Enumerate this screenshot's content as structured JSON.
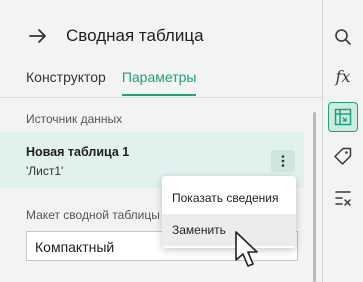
{
  "header": {
    "title": "Сводная таблица"
  },
  "tabs": [
    {
      "label": "Конструктор",
      "active": false
    },
    {
      "label": "Параметры",
      "active": true
    }
  ],
  "data_source": {
    "section_label": "Источник данных",
    "name": "Новая таблица 1",
    "sheet": "'Лист1'"
  },
  "layout": {
    "section_label": "Макет сводной таблицы",
    "selected": "Компактный"
  },
  "context_menu": {
    "items": [
      {
        "label": "Показать сведения"
      },
      {
        "label": "Заменить"
      }
    ]
  },
  "right_rail": {
    "fx_label": "fx",
    "icons": [
      "search-icon",
      "formula-icon",
      "pivot-table-icon",
      "tag-icon",
      "checklist-icon"
    ]
  },
  "colors": {
    "accent": "#1aa37a",
    "selected_row": "#e1f1ee"
  }
}
